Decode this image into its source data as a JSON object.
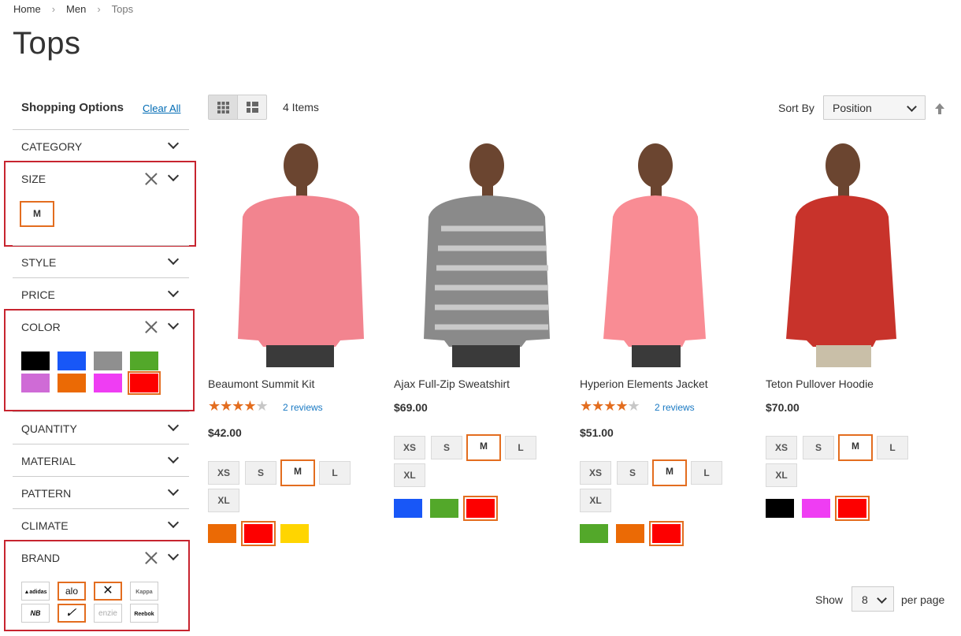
{
  "breadcrumb": {
    "home": "Home",
    "men": "Men",
    "current": "Tops"
  },
  "page_title": "Tops",
  "sidebar": {
    "title": "Shopping Options",
    "clear_all": "Clear All",
    "filters": {
      "category": "CATEGORY",
      "size": "SIZE",
      "style": "STYLE",
      "price": "PRICE",
      "color": "COLOR",
      "quantity": "QUANTITY",
      "material": "MATERIAL",
      "pattern": "PATTERN",
      "climate": "CLIMATE",
      "brand": "BRAND"
    },
    "size_selected": "M",
    "colors": [
      {
        "hex": "#000000",
        "selected": false
      },
      {
        "hex": "#1857f7",
        "selected": false
      },
      {
        "hex": "#8f8f8f",
        "selected": false
      },
      {
        "hex": "#53a82a",
        "selected": false
      },
      {
        "hex": "#cf6bd6",
        "selected": false
      },
      {
        "hex": "#eb6a05",
        "selected": false
      },
      {
        "hex": "#ef3df3",
        "selected": false
      },
      {
        "hex": "#fd0000",
        "selected": true
      }
    ],
    "brands": [
      {
        "name": "adidas",
        "selected": false
      },
      {
        "name": "alo",
        "selected": true
      },
      {
        "name": "Under Armour",
        "selected": true
      },
      {
        "name": "Kappa",
        "selected": false
      },
      {
        "name": "New Balance",
        "selected": false
      },
      {
        "name": "Nike",
        "selected": true
      },
      {
        "name": "enzie",
        "selected": false
      },
      {
        "name": "Reebok",
        "selected": false
      }
    ]
  },
  "toolbar": {
    "items_count": "4 Items",
    "sort_by_label": "Sort By",
    "sort_value": "Position",
    "view_modes": [
      "grid-icon",
      "list-icon"
    ],
    "active_mode": "grid"
  },
  "products": [
    {
      "name": "Beaumont Summit Kit",
      "rating_percent": 87,
      "reviews": "2 reviews",
      "price": "$42.00",
      "sizes": [
        "XS",
        "S",
        "M",
        "L",
        "XL"
      ],
      "selected_size": "M",
      "colors": [
        {
          "hex": "#eb6a05",
          "selected": false
        },
        {
          "hex": "#fd0000",
          "selected": true
        },
        {
          "hex": "#ffd500",
          "selected": false
        }
      ]
    },
    {
      "name": "Ajax Full-Zip Sweatshirt",
      "rating_percent": null,
      "reviews": "",
      "price": "$69.00",
      "sizes": [
        "XS",
        "S",
        "M",
        "L",
        "XL"
      ],
      "selected_size": "M",
      "colors": [
        {
          "hex": "#1857f7",
          "selected": false
        },
        {
          "hex": "#53a82a",
          "selected": false
        },
        {
          "hex": "#fd0000",
          "selected": true
        }
      ]
    },
    {
      "name": "Hyperion Elements Jacket",
      "rating_percent": 87,
      "reviews": "2 reviews",
      "price": "$51.00",
      "sizes": [
        "XS",
        "S",
        "M",
        "L",
        "XL"
      ],
      "selected_size": "M",
      "colors": [
        {
          "hex": "#53a82a",
          "selected": false
        },
        {
          "hex": "#eb6a05",
          "selected": false
        },
        {
          "hex": "#fd0000",
          "selected": true
        }
      ]
    },
    {
      "name": "Teton Pullover Hoodie",
      "rating_percent": null,
      "reviews": "",
      "price": "$70.00",
      "sizes": [
        "XS",
        "S",
        "M",
        "L",
        "XL"
      ],
      "selected_size": "M",
      "colors": [
        {
          "hex": "#000000",
          "selected": false
        },
        {
          "hex": "#ef3df3",
          "selected": false
        },
        {
          "hex": "#fd0000",
          "selected": true
        }
      ]
    }
  ],
  "pager": {
    "show_label": "Show",
    "per_page_value": "8",
    "per_page_label": "per page"
  },
  "accent_color": "#e36d1f",
  "highlight_color": "#c7242f"
}
